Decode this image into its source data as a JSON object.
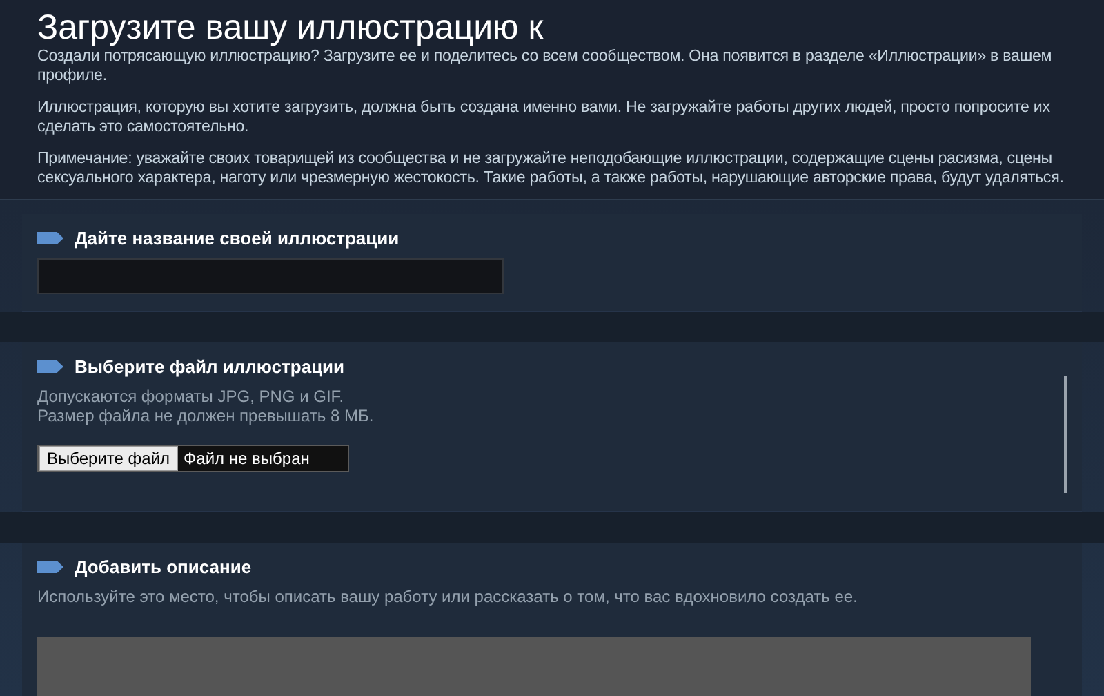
{
  "title": "Загрузите вашу иллюстрацию к",
  "intro": [
    "Создали потрясающую иллюстрацию? Загрузите ее и поделитесь со всем сообществом. Она появится в разделе «Иллюстрации» в вашем профиле.",
    "Иллюстрация, которую вы хотите загрузить, должна быть создана именно вами. Не загружайте работы других людей, просто попросите их сделать это самостоятельно.",
    "Примечание: уважайте своих товарищей из сообщества и не загружайте неподобающие иллюстрации, содержащие сцены расизма, сцены сексуального характера, наготу или чрезмерную жестокость. Такие работы, а также работы, нарушающие авторские права, будут удаляться."
  ],
  "sections": [
    {
      "kind": "name",
      "heading": "Дайте название своей иллюстрации"
    },
    {
      "kind": "file",
      "heading": "Выберите файл иллюстрации",
      "hints": [
        "Допускаются форматы JPG, PNG и GIF.",
        "Размер файла не должен превышать 8 МБ."
      ],
      "button": "Выберите файл",
      "file_status": "Файл не выбран"
    },
    {
      "kind": "description",
      "heading": "Добавить описание",
      "hints": [
        "Используйте это место, чтобы описать вашу работу или рассказать о том, что вас вдохновило создать ее."
      ]
    }
  ]
}
